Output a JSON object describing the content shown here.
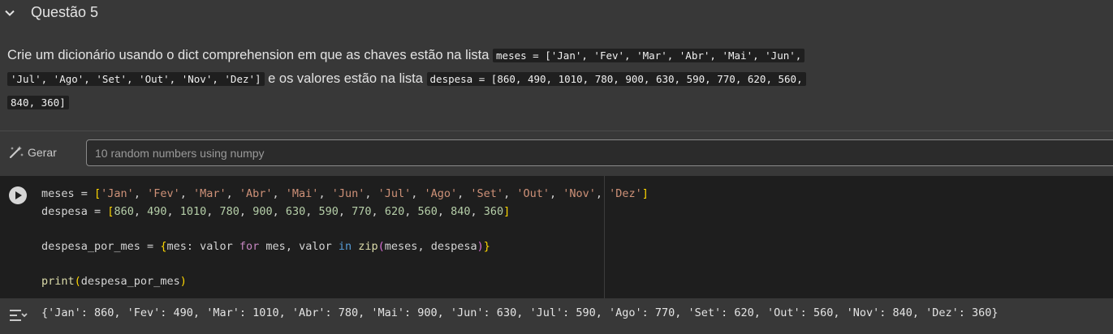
{
  "section": {
    "title": "Questão 5",
    "collapse_icon": "chevron-down-icon"
  },
  "text_cell": {
    "intro": "Crie um dicionário usando o dict comprehension em que as chaves estão na lista",
    "code1": "meses = ['Jan', 'Fev', 'Mar', 'Abr', 'Mai', 'Jun',",
    "code2": "'Jul', 'Ago', 'Set', 'Out', 'Nov', 'Dez']",
    "mid": "e os valores estão na lista",
    "code3": "despesa = [860, 490, 1010, 780, 900, 630, 590, 770, 620, 560,",
    "code4": "840, 360]"
  },
  "generate": {
    "label": "Gerar",
    "icon": "magic-wand-icon",
    "placeholder": "10 random numbers using numpy"
  },
  "code_cell": {
    "run_icon": "play-icon",
    "lines": [
      "meses = ['Jan', 'Fev', 'Mar', 'Abr', 'Mai', 'Jun', 'Jul', 'Ago', 'Set', 'Out', 'Nov', 'Dez']",
      "despesa = [860, 490, 1010, 780, 900, 630, 590, 770, 620, 560, 840, 360]",
      "",
      "despesa_por_mes = {mes: valor for mes, valor in zip(meses, despesa)}",
      "",
      "print(despesa_por_mes)"
    ]
  },
  "output": {
    "icon": "output-icon",
    "text": "{'Jan': 860, 'Fev': 490, 'Mar': 1010, 'Abr': 780, 'Mai': 900, 'Jun': 630, 'Jul': 590, 'Ago': 770, 'Set': 620, 'Out': 560, 'Nov': 840, 'Dez': 360}"
  },
  "colors": {
    "background": "#383838",
    "code_background": "#1e1e1e",
    "keyword": "#c586c0",
    "string": "#ce9178",
    "number": "#b5cea8",
    "builtin": "#dcdcaa"
  }
}
